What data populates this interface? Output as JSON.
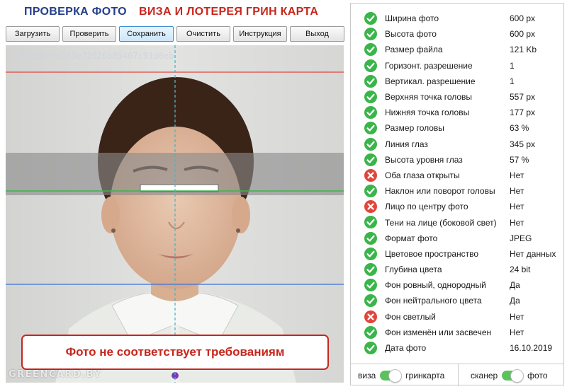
{
  "header": {
    "title_left": "ПРОВЕРКА ФОТО",
    "title_right": "ВИЗА И ЛОТЕРЕЯ ГРИН КАРТА"
  },
  "toolbar": {
    "load": "Загрузить",
    "check": "Проверить",
    "save": "Сохранить",
    "clear": "Очистить",
    "instructions": "Инструкция",
    "exit": "Выход",
    "active": "save"
  },
  "photo": {
    "hash": "bb15e23cce103e72626b05407c91d0eb",
    "watermark": "GREENCARD.BY",
    "result": "Фото не соответствует требованиям"
  },
  "colors": {
    "ok": "#3ab54a",
    "fail": "#e0463a",
    "title_blue": "#233e8b",
    "title_red": "#c8261c",
    "toggle_on": "#5cc25c"
  },
  "checks": [
    {
      "label": "Ширина фото",
      "value": "600 px",
      "status": "ok"
    },
    {
      "label": "Высота фото",
      "value": "600 px",
      "status": "ok"
    },
    {
      "label": "Размер файла",
      "value": "121 Kb",
      "status": "ok"
    },
    {
      "label": "Горизонт. разрешение",
      "value": "1",
      "status": "ok"
    },
    {
      "label": "Вертикал. разрешение",
      "value": "1",
      "status": "ok"
    },
    {
      "label": "Верхняя точка головы",
      "value": "557 px",
      "status": "ok"
    },
    {
      "label": "Нижняя точка головы",
      "value": "177 px",
      "status": "ok"
    },
    {
      "label": "Размер головы",
      "value": "63 %",
      "status": "ok"
    },
    {
      "label": "Линия глаз",
      "value": "345 px",
      "status": "ok"
    },
    {
      "label": "Высота уровня глаз",
      "value": "57 %",
      "status": "ok"
    },
    {
      "label": "Оба глаза открыты",
      "value": "Нет",
      "status": "fail"
    },
    {
      "label": "Наклон или поворот головы",
      "value": "Нет",
      "status": "ok"
    },
    {
      "label": "Лицо по центру фото",
      "value": "Нет",
      "status": "fail"
    },
    {
      "label": "Тени на лице (боковой свет)",
      "value": "Нет",
      "status": "ok"
    },
    {
      "label": "Формат фото",
      "value": "JPEG",
      "status": "ok"
    },
    {
      "label": "Цветовое пространство",
      "value": "Нет данных",
      "status": "ok"
    },
    {
      "label": "Глубина цвета",
      "value": "24 bit",
      "status": "ok"
    },
    {
      "label": "Фон ровный, однородный",
      "value": "Да",
      "status": "ok"
    },
    {
      "label": "Фон нейтрального цвета",
      "value": "Да",
      "status": "ok"
    },
    {
      "label": "Фон светлый",
      "value": "Нет",
      "status": "fail"
    },
    {
      "label": "Фон изменён или засвечен",
      "value": "Нет",
      "status": "ok"
    },
    {
      "label": "Дата фото",
      "value": "16.10.2019",
      "status": "ok"
    }
  ],
  "toggles": {
    "mode_left": "виза",
    "mode_right": "гринкарта",
    "source_left": "сканер",
    "source_right": "фото"
  }
}
